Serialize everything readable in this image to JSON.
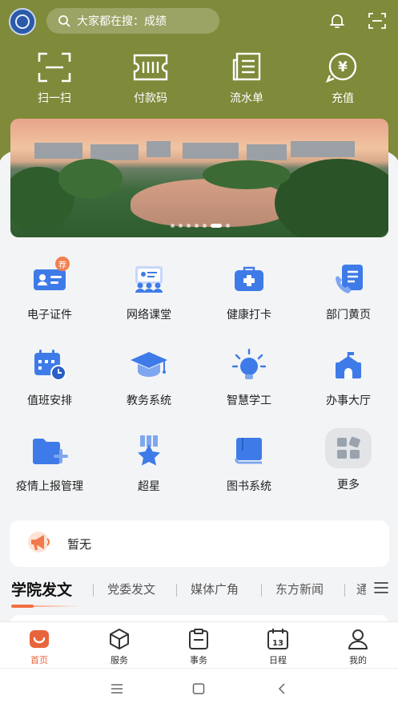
{
  "header": {
    "search_placeholder": "大家都在搜：成绩"
  },
  "quick_actions": [
    {
      "label": "扫一扫",
      "icon": "scan-icon"
    },
    {
      "label": "付款码",
      "icon": "payment-code-icon"
    },
    {
      "label": "流水单",
      "icon": "statement-icon"
    },
    {
      "label": "充值",
      "icon": "recharge-icon"
    }
  ],
  "banner": {
    "slide_count": 7,
    "active_slide": 6
  },
  "services": [
    {
      "label": "电子证件",
      "icon": "id-card-icon",
      "badge": "荐"
    },
    {
      "label": "网络课堂",
      "icon": "online-class-icon"
    },
    {
      "label": "健康打卡",
      "icon": "health-kit-icon"
    },
    {
      "label": "部门黄页",
      "icon": "phone-book-icon"
    },
    {
      "label": "值班安排",
      "icon": "duty-calendar-icon"
    },
    {
      "label": "教务系统",
      "icon": "graduation-cap-icon"
    },
    {
      "label": "智慧学工",
      "icon": "lightbulb-icon"
    },
    {
      "label": "办事大厅",
      "icon": "hall-building-icon"
    },
    {
      "label": "疫情上报管理",
      "icon": "folder-add-icon"
    },
    {
      "label": "超星",
      "icon": "star-ribbon-icon"
    },
    {
      "label": "图书系统",
      "icon": "book-icon"
    },
    {
      "label": "更多",
      "icon": "more-grid-icon"
    }
  ],
  "notice": {
    "text": "暂无",
    "icon": "megaphone-icon"
  },
  "news_tabs": [
    {
      "label": "学院发文",
      "active": true
    },
    {
      "label": "党委发文"
    },
    {
      "label": "媒体广角"
    },
    {
      "label": "东方新闻"
    },
    {
      "label": "通"
    }
  ],
  "bottom_nav": [
    {
      "label": "首页",
      "icon": "home-icon",
      "active": true
    },
    {
      "label": "服务",
      "icon": "box-icon"
    },
    {
      "label": "事务",
      "icon": "clipboard-icon"
    },
    {
      "label": "日程",
      "icon": "calendar-icon"
    },
    {
      "label": "我的",
      "icon": "user-icon"
    }
  ],
  "colors": {
    "header_bg": "#7f8a3a",
    "accent": "#e8643c",
    "icon_blue": "#3f7be8"
  }
}
